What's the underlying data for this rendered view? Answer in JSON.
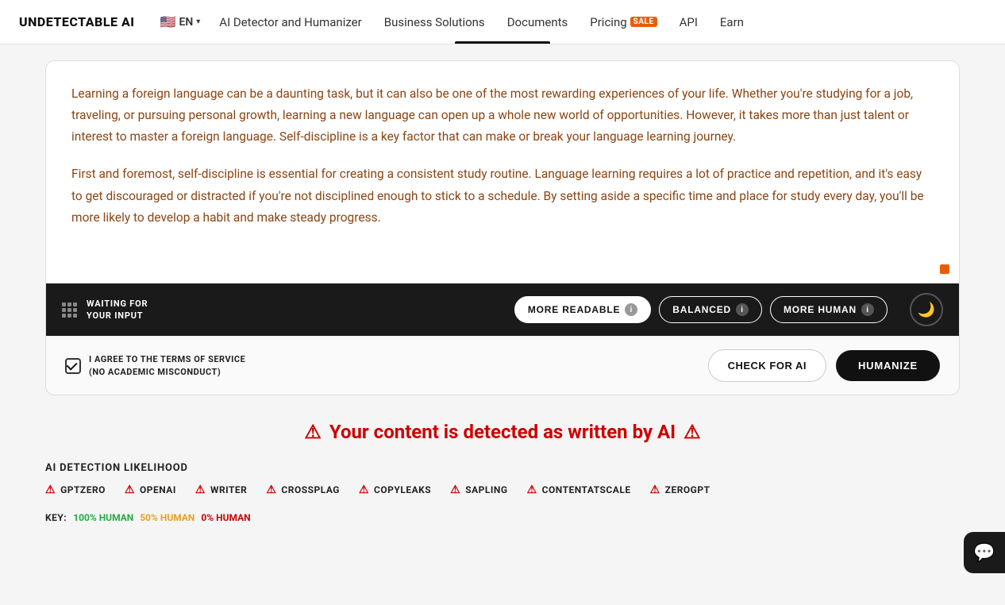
{
  "nav": {
    "logo": "UNDETECTABLE AI",
    "locale": {
      "flag": "🇺🇸",
      "lang": "EN",
      "chevron": "▾"
    },
    "links": [
      {
        "id": "ai-detector",
        "label": "AI Detector and Humanizer"
      },
      {
        "id": "business",
        "label": "Business Solutions"
      },
      {
        "id": "documents",
        "label": "Documents"
      },
      {
        "id": "pricing",
        "label": "Pricing",
        "badge": "SALE"
      },
      {
        "id": "api",
        "label": "API"
      },
      {
        "id": "earn",
        "label": "Earn"
      }
    ]
  },
  "editor": {
    "text_paragraphs": [
      "Learning a foreign language can be a daunting task, but it can also be one of the most rewarding experiences of your life. Whether you're studying for a job, traveling, or pursuing personal growth, learning a new language can open up a whole new world of opportunities. However, it takes more than just talent or interest to master a foreign language. Self-discipline is a key factor that can make or break your language learning journey.",
      "First and foremost, self-discipline is essential for creating a consistent study routine. Language learning requires a lot of practice and repetition, and it's easy to get discouraged or distracted if you're not disciplined enough to stick to a schedule. By setting aside a specific time and place for study every day, you'll be more likely to develop a habit and make steady progress."
    ],
    "toolbar": {
      "status_line1": "WAITING FOR",
      "status_line2": "YOUR INPUT",
      "modes": [
        {
          "id": "more-readable",
          "label": "MORE READABLE",
          "active": true
        },
        {
          "id": "balanced",
          "label": "BALANCED",
          "active": false
        },
        {
          "id": "more-human",
          "label": "MORE HUMAN",
          "active": false
        }
      ]
    },
    "footer": {
      "terms_line1": "I AGREE TO THE TERMS OF SERVICE",
      "terms_line2": "(NO ACADEMIC MISCONDUCT)",
      "check_ai_label": "CHECK FOR AI",
      "humanize_label": "HUMANIZE"
    }
  },
  "detection": {
    "warning_text": "⚠ Your content is detected as written by AI ⚠",
    "likelihood_title": "AI DETECTION LIKELIHOOD",
    "detectors": [
      "GPTZERO",
      "OPENAI",
      "WRITER",
      "CROSSPLAG",
      "COPYLEAKS",
      "SAPLING",
      "CONTENTATSCALE",
      "ZEROGPT"
    ],
    "key": {
      "label": "KEY:",
      "entries": [
        {
          "id": "100",
          "text": "100% HUMAN",
          "color": "green"
        },
        {
          "id": "50",
          "text": "50% HUMAN",
          "color": "orange"
        },
        {
          "id": "0",
          "text": "0% HUMAN",
          "color": "red"
        }
      ]
    }
  }
}
